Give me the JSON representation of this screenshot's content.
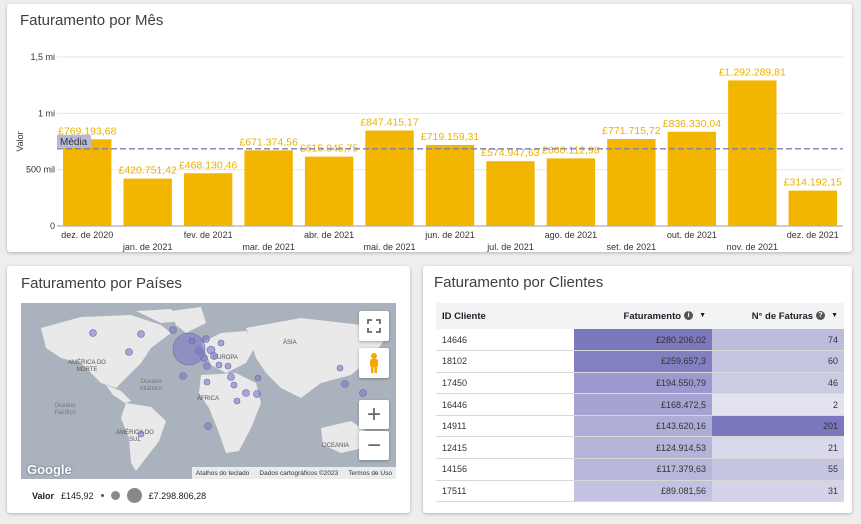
{
  "monthly": {
    "title": "Faturamento por Mês",
    "chart_data": {
      "type": "bar",
      "categories": [
        "dez. de 2020",
        "jan. de 2021",
        "fev. de 2021",
        "mar. de 2021",
        "abr. de 2021",
        "mai. de 2021",
        "jun. de 2021",
        "jul. de 2021",
        "ago. de 2021",
        "set. de 2021",
        "out. de 2021",
        "nov. de 2021",
        "dez. de 2021"
      ],
      "values": [
        769193.68,
        420751.42,
        468130.46,
        671374.56,
        615945.75,
        847415.17,
        719159.31,
        574947.63,
        600112.98,
        771715.72,
        836330.04,
        1292289.81,
        314192.15
      ],
      "data_labels": [
        "£769.193,68",
        "£420.751,42",
        "£468.130,46",
        "£671.374,56",
        "£615.945,75",
        "£847.415,17",
        "£719.159,31",
        "£574.947,63",
        "£600.112,98",
        "£771.715,72",
        "£836.330,04",
        "£1.292.289,81",
        "£314.192,15"
      ],
      "ylabel": "Valor",
      "ylim": [
        0,
        1500000
      ],
      "y_ticks": [
        0,
        500000,
        1000000,
        1500000
      ],
      "y_tick_labels": [
        "0",
        "500 mil",
        "1 mi",
        "1,5 mi"
      ],
      "reference_line": {
        "label": "Média",
        "value": 685000
      },
      "bar_color": "#f2b600",
      "label_color": "#eab200",
      "grid": true
    }
  },
  "countries": {
    "title": "Faturamento por Países",
    "map_labels": {
      "north_america": "AMÉRICA DO NORTE",
      "south_america": "AMÉRICA DO SUL",
      "europe": "EUROPA",
      "asia": "ÁSIA",
      "africa": "ÁFRICA",
      "oceania": "OCEANIA",
      "atlantic": "Oceano Atlântico",
      "pacific": "Oceano Pacífico"
    },
    "attribution": [
      "Atalhos do teclado",
      "Dados cartográficos ©2023",
      "Termos de Uso"
    ],
    "logo": "Google",
    "legend": {
      "label": "Valor",
      "min": "£145,92",
      "max": "£7.298.806,28"
    },
    "icons": [
      "fullscreen-icon",
      "pegman-icon",
      "zoom-in-icon",
      "zoom-out-icon"
    ],
    "bubble_color": "#7b78c4"
  },
  "clients": {
    "title": "Faturamento por Clientes",
    "columns": [
      "ID Cliente",
      "Faturamento",
      "N° de Faturas"
    ],
    "rows": [
      {
        "id": "14646",
        "revenue": "£280.206,02",
        "invoices": "74"
      },
      {
        "id": "18102",
        "revenue": "£259.657,3",
        "invoices": "60"
      },
      {
        "id": "17450",
        "revenue": "£194.550,79",
        "invoices": "46"
      },
      {
        "id": "16446",
        "revenue": "£168.472,5",
        "invoices": "2"
      },
      {
        "id": "14911",
        "revenue": "£143.620,16",
        "invoices": "201"
      },
      {
        "id": "12415",
        "revenue": "£124.914,53",
        "invoices": "21"
      },
      {
        "id": "14156",
        "revenue": "£117.379,63",
        "invoices": "55"
      },
      {
        "id": "17511",
        "revenue": "£89.081,56",
        "invoices": "31"
      }
    ],
    "revenue_values": [
      280206.02,
      259657.3,
      194550.79,
      168472.5,
      143620.16,
      124914.53,
      117379.63,
      89081.56
    ],
    "invoice_values": [
      74,
      60,
      46,
      2,
      201,
      21,
      55,
      31
    ],
    "heat_color": "#7b78bd"
  }
}
